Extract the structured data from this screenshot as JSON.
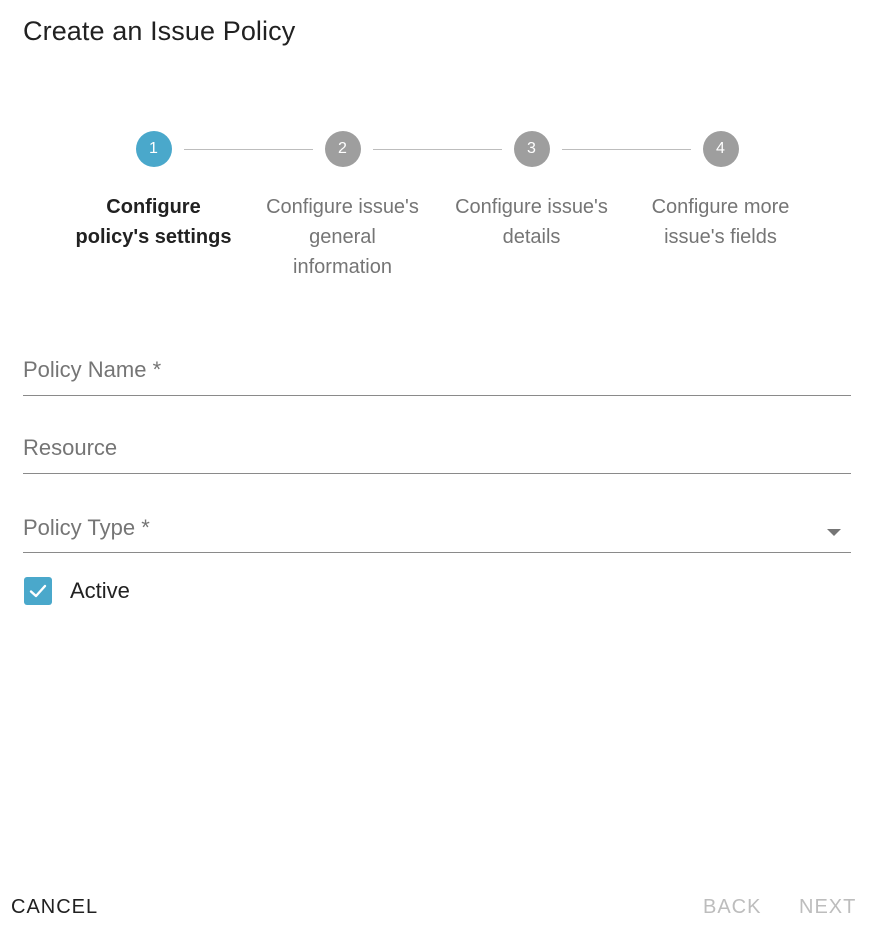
{
  "dialog": {
    "title": "Create an Issue Policy"
  },
  "stepper": {
    "active_step": 1,
    "steps": [
      {
        "number": "1",
        "label_line1": "Configure",
        "label_line2": "policy's settings",
        "label_line3": ""
      },
      {
        "number": "2",
        "label_line1": "Configure issue's",
        "label_line2": "general",
        "label_line3": "information"
      },
      {
        "number": "3",
        "label_line1": "Configure issue's",
        "label_line2": "details",
        "label_line3": ""
      },
      {
        "number": "4",
        "label_line1": "Configure more",
        "label_line2": "issue's fields",
        "label_line3": ""
      }
    ]
  },
  "form": {
    "policy_name": {
      "label": "Policy Name *",
      "value": ""
    },
    "resource": {
      "label": "Resource",
      "value": ""
    },
    "policy_type": {
      "label": "Policy Type *",
      "value": ""
    },
    "active": {
      "label": "Active",
      "checked": true
    }
  },
  "footer": {
    "cancel_label": "CANCEL",
    "back_label": "BACK",
    "next_label": "NEXT"
  },
  "colors": {
    "accent": "#4aa8cb",
    "inactive_step": "#9e9e9e",
    "disabled_text": "#bdbdbd"
  }
}
